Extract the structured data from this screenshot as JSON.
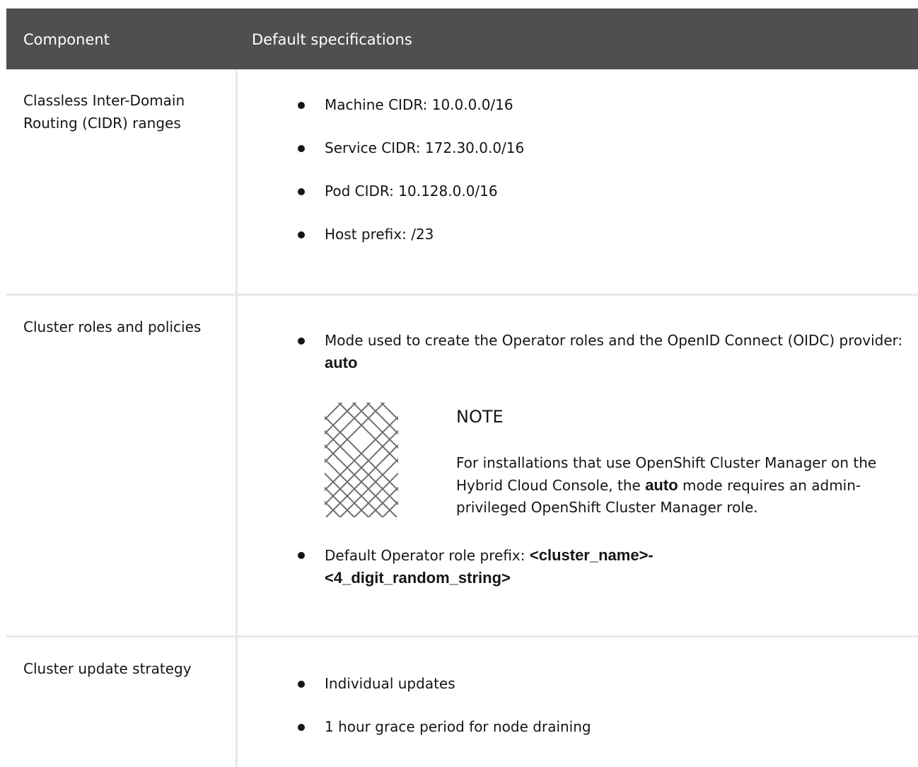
{
  "table": {
    "headers": {
      "component": "Component",
      "specs": "Default specifications"
    },
    "rows": [
      {
        "component": "Classless Inter-Domain Routing (CIDR) ranges",
        "items": [
          "Machine CIDR: 10.0.0.0/16",
          "Service CIDR: 172.30.0.0/16",
          "Pod CIDR: 10.128.0.0/16",
          "Host prefix: /23"
        ]
      },
      {
        "component": "Cluster roles and policies",
        "mode_item": {
          "text": "Mode used to create the Operator roles and the OpenID Connect (OIDC) provider: ",
          "value": "auto"
        },
        "note": {
          "icon": "note-icon",
          "title": "NOTE",
          "body_before": "For installations that use OpenShift Cluster Manager on the Hybrid Cloud Console, the ",
          "body_bold": "auto",
          "body_after": " mode requires an admin-privileged OpenShift Cluster Manager role."
        },
        "prefix_item": {
          "text": "Default Operator role prefix: ",
          "value_line1": "<cluster_name>-",
          "value_line2": "<4_digit_random_string>"
        }
      },
      {
        "component": "Cluster update strategy",
        "items": [
          "Individual updates",
          "1 hour grace period for node draining"
        ]
      }
    ]
  }
}
